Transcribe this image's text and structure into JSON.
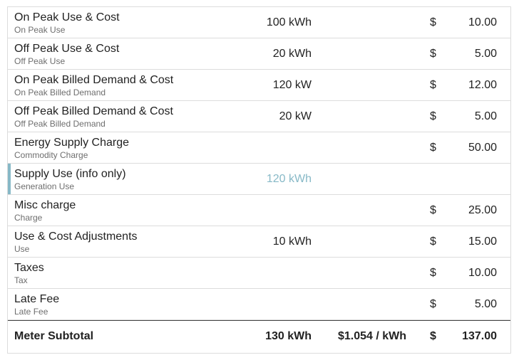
{
  "rows": [
    {
      "name": "On Peak Use & Cost",
      "sub": "On Peak Use",
      "qty": "100 kWh",
      "currency": "$",
      "amount": "10.00"
    },
    {
      "name": "Off Peak Use & Cost",
      "sub": "Off Peak Use",
      "qty": "20 kWh",
      "currency": "$",
      "amount": "5.00"
    },
    {
      "name": "On Peak Billed Demand & Cost",
      "sub": "On Peak Billed Demand",
      "qty": "120 kW",
      "currency": "$",
      "amount": "12.00"
    },
    {
      "name": "Off Peak Billed Demand & Cost",
      "sub": "Off Peak Billed Demand",
      "qty": "20 kW",
      "currency": "$",
      "amount": "5.00"
    },
    {
      "name": "Energy Supply Charge",
      "sub": "Commodity Charge",
      "qty": "",
      "currency": "$",
      "amount": "50.00"
    },
    {
      "name": "Supply Use (info only)",
      "sub": "Generation Use",
      "qty": "120 kWh",
      "currency": "",
      "amount": ""
    },
    {
      "name": "Misc charge",
      "sub": "Charge",
      "qty": "",
      "currency": "$",
      "amount": "25.00"
    },
    {
      "name": "Use & Cost Adjustments",
      "sub": "Use",
      "qty": "10 kWh",
      "currency": "$",
      "amount": "15.00"
    },
    {
      "name": "Taxes",
      "sub": "Tax",
      "qty": "",
      "currency": "$",
      "amount": "10.00"
    },
    {
      "name": "Late Fee",
      "sub": "Late Fee",
      "qty": "",
      "currency": "$",
      "amount": "5.00"
    }
  ],
  "subtotal": {
    "label": "Meter Subtotal",
    "qty": "130 kWh",
    "rate": "$1.054 / kWh",
    "currency": "$",
    "amount": "137.00"
  },
  "colors": {
    "info_accent": "#87b9c7",
    "border": "#dcdcdc"
  }
}
